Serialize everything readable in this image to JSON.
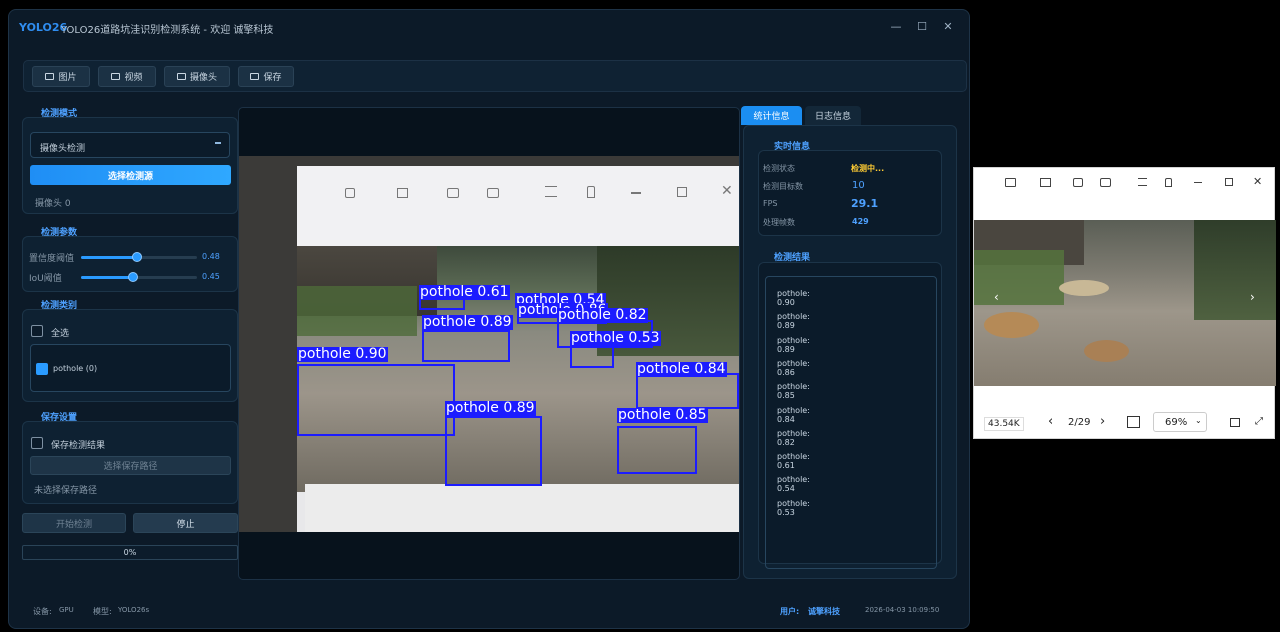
{
  "app": {
    "brand": "YOLO26",
    "title": "YOLO26道路坑洼识别检测系统 - 欢迎 诚擎科技",
    "window_controls": [
      "—",
      "☐",
      "✕"
    ]
  },
  "toolbar": {
    "image_label": "图片",
    "video_label": "视频",
    "camera_label": "摄像头",
    "save_label": "保存"
  },
  "left": {
    "mode_title": "检测模式",
    "mode_value": "摄像头检测",
    "select_source_label": "选择检测源",
    "camera_label": "摄像头 0",
    "params_title": "检测参数",
    "conf_label": "置信度阈值",
    "conf_value": "0.48",
    "conf_level": 0.48,
    "iou_label": "IoU阈值",
    "iou_value": "0.45",
    "iou_level": 0.45,
    "classes_title": "检测类别",
    "select_all_label": "全选",
    "class_item": "pothole (0)",
    "save_title": "保存设置",
    "save_result_label": "保存检测结果",
    "select_save_path_label": "选择保存路径",
    "no_path_label": "未选择保存路径",
    "start_label": "开始检测",
    "stop_label": "停止",
    "progress_text": "0%",
    "progress_level": 0
  },
  "right": {
    "tab_stats": "统计信息",
    "tab_log": "日志信息",
    "realtime_title": "实时信息",
    "stat_labels": [
      "检测状态",
      "检测目标数",
      "FPS",
      "处理帧数"
    ],
    "status_value": "检测中...",
    "targets_value": "10",
    "fps_value": "29.1",
    "frames_value": "429",
    "results_title": "检测结果",
    "results": [
      "pothole: 0.90",
      "pothole: 0.89",
      "pothole: 0.89",
      "pothole: 0.86",
      "pothole: 0.85",
      "pothole: 0.84",
      "pothole: 0.82",
      "pothole: 0.61",
      "pothole: 0.54",
      "pothole: 0.53"
    ]
  },
  "detections": [
    "pothole 0.61",
    "pothole 0.54",
    "pothole 0.86",
    "pothole 0.82",
    "pothole 0.89",
    "pothole 0.53",
    "pothole 0.90",
    "pothole 0.84",
    "pothole 0.89",
    "pothole 0.85"
  ],
  "status": {
    "device_label": "设备:",
    "device_value": "GPU",
    "model_label": "模型:",
    "model_value": "YOLO26s",
    "user_label": "用户:",
    "user_value": "诚擎科技",
    "datetime": "2026-04-03 10:09:50"
  },
  "viewer": {
    "size": "43.54K",
    "page": "2/29",
    "zoom": "69%"
  },
  "colors": {
    "accent": "#2a9bff",
    "status_value": "#ffcc33",
    "box": "#1c1cff"
  }
}
